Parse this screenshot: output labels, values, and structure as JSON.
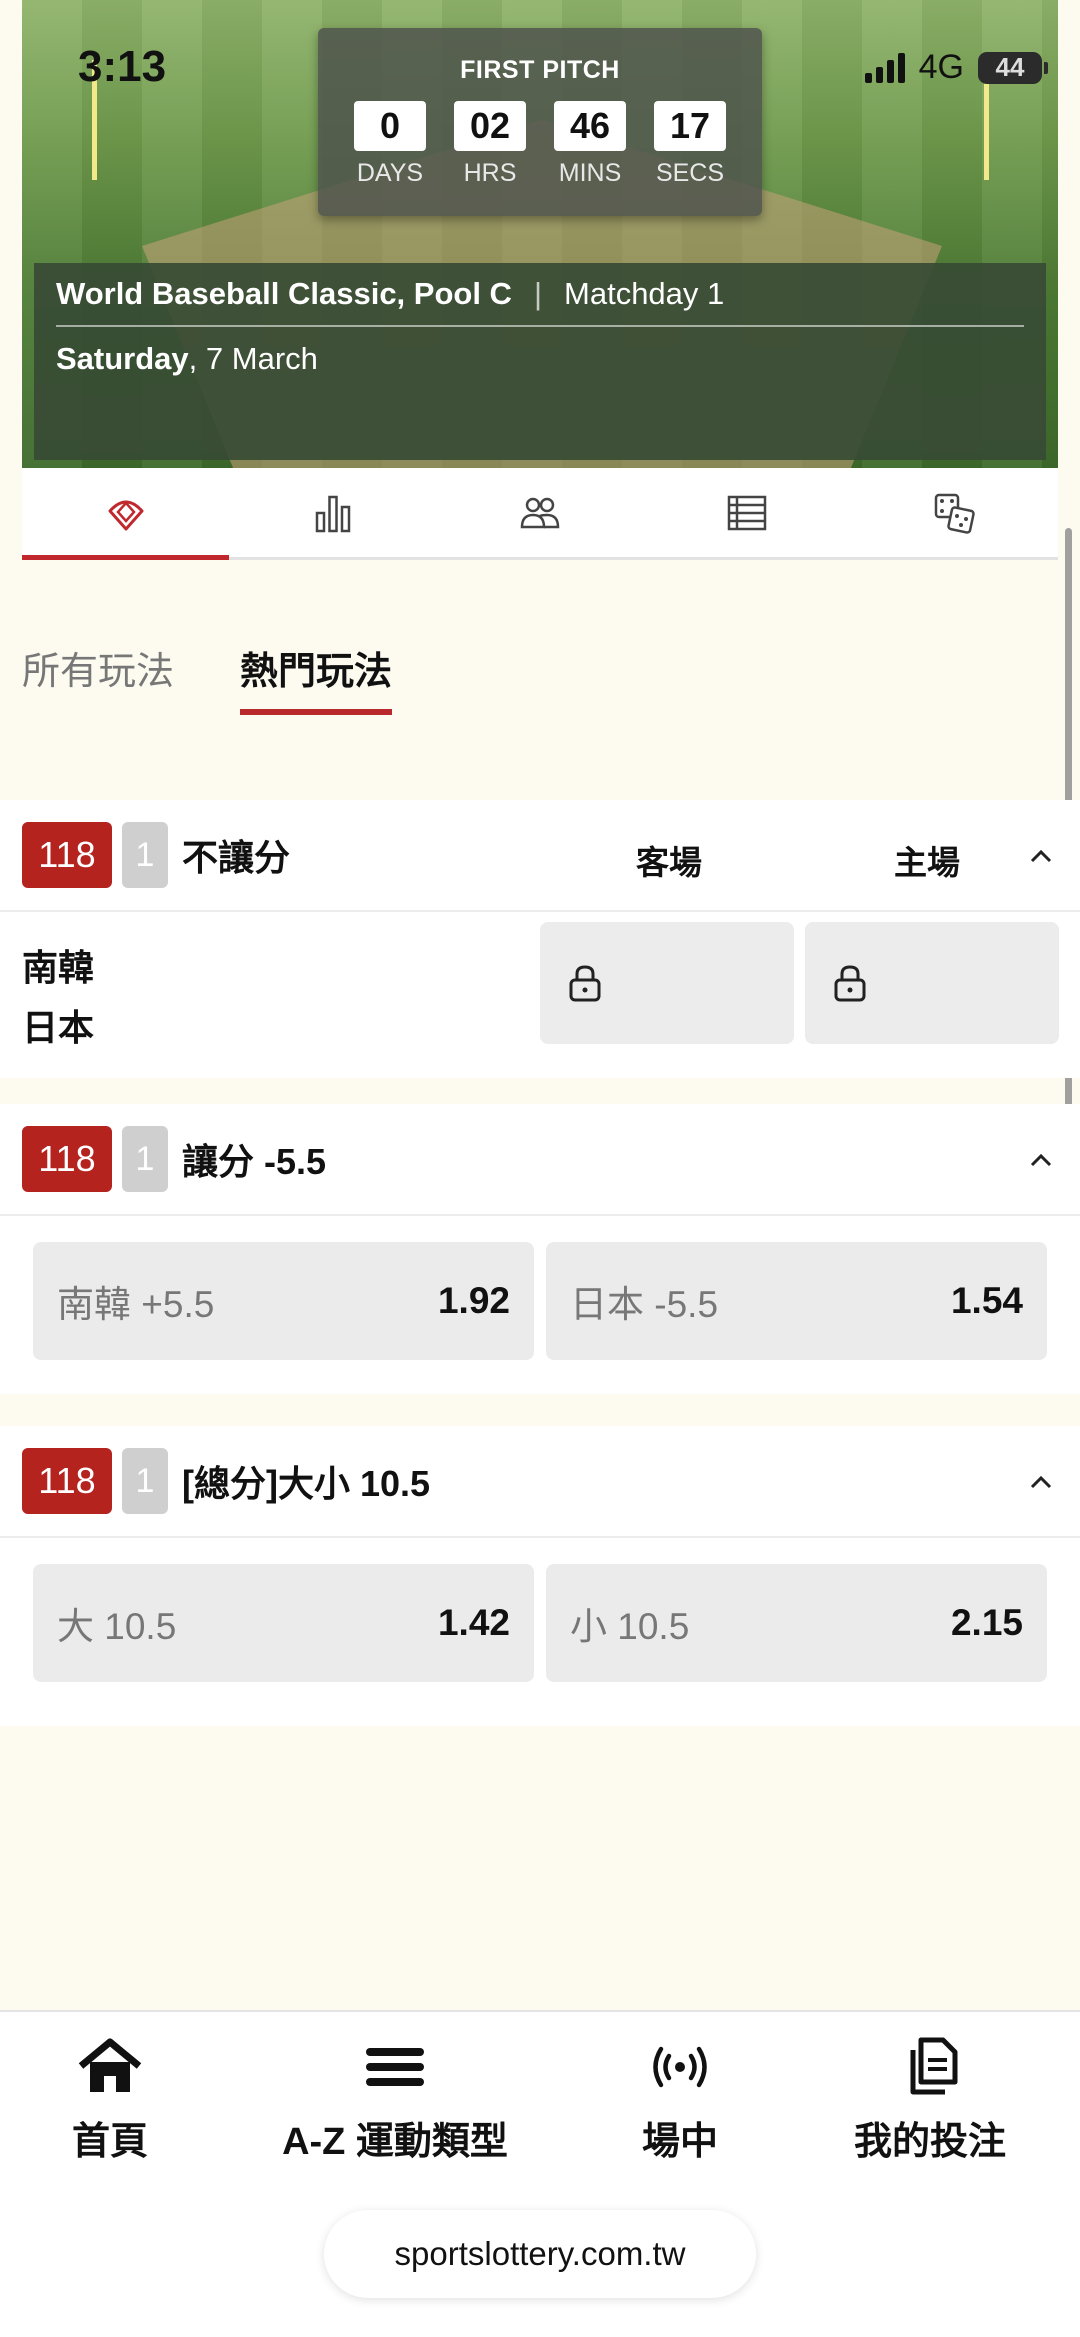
{
  "status_bar": {
    "time": "3:13",
    "network": "4G",
    "battery": "44"
  },
  "countdown": {
    "label": "FIRST PITCH",
    "units": [
      {
        "value": "0",
        "caption": "DAYS"
      },
      {
        "value": "02",
        "caption": "HRS"
      },
      {
        "value": "46",
        "caption": "MINS"
      },
      {
        "value": "17",
        "caption": "SECS"
      }
    ]
  },
  "match": {
    "competition": "World Baseball Classic, Pool C",
    "separator": "|",
    "matchday": "Matchday 1",
    "day": "Saturday",
    "date": ", 7 March"
  },
  "icon_tabs": [
    {
      "icon": "baseball-diamond-icon",
      "active": true
    },
    {
      "icon": "bar-chart-icon",
      "active": false
    },
    {
      "icon": "players-icon",
      "active": false
    },
    {
      "icon": "list-table-icon",
      "active": false
    },
    {
      "icon": "dice-icon",
      "active": false
    }
  ],
  "play_tabs": [
    {
      "label": "所有玩法",
      "active": false
    },
    {
      "label": "熱門玩法",
      "active": true
    }
  ],
  "markets": [
    {
      "code": "118",
      "count": "1",
      "title": "不讓分",
      "away_header": "客場",
      "home_header": "主場",
      "teams": [
        "南韓",
        "日本"
      ],
      "locked": true
    },
    {
      "code": "118",
      "count": "1",
      "title": "讓分 -5.5",
      "options": [
        {
          "label": "南韓 +5.5",
          "odds": "1.92"
        },
        {
          "label": "日本 -5.5",
          "odds": "1.54"
        }
      ]
    },
    {
      "code": "118",
      "count": "1",
      "title": "[總分]大小 10.5",
      "options": [
        {
          "label": "大 10.5",
          "odds": "1.42"
        },
        {
          "label": "小 10.5",
          "odds": "2.15"
        }
      ]
    }
  ],
  "bottom_nav": [
    {
      "label": "首頁",
      "icon": "home-icon"
    },
    {
      "label": "A-Z 運動類型",
      "icon": "menu-icon"
    },
    {
      "label": "場中",
      "icon": "live-broadcast-icon"
    },
    {
      "label": "我的投注",
      "icon": "bet-slip-icon"
    }
  ],
  "browser": {
    "url": "sportslottery.com.tw"
  },
  "colors": {
    "accent": "#b5231f",
    "page_bg": "#fdfbf0",
    "button_bg": "#ebebeb"
  }
}
